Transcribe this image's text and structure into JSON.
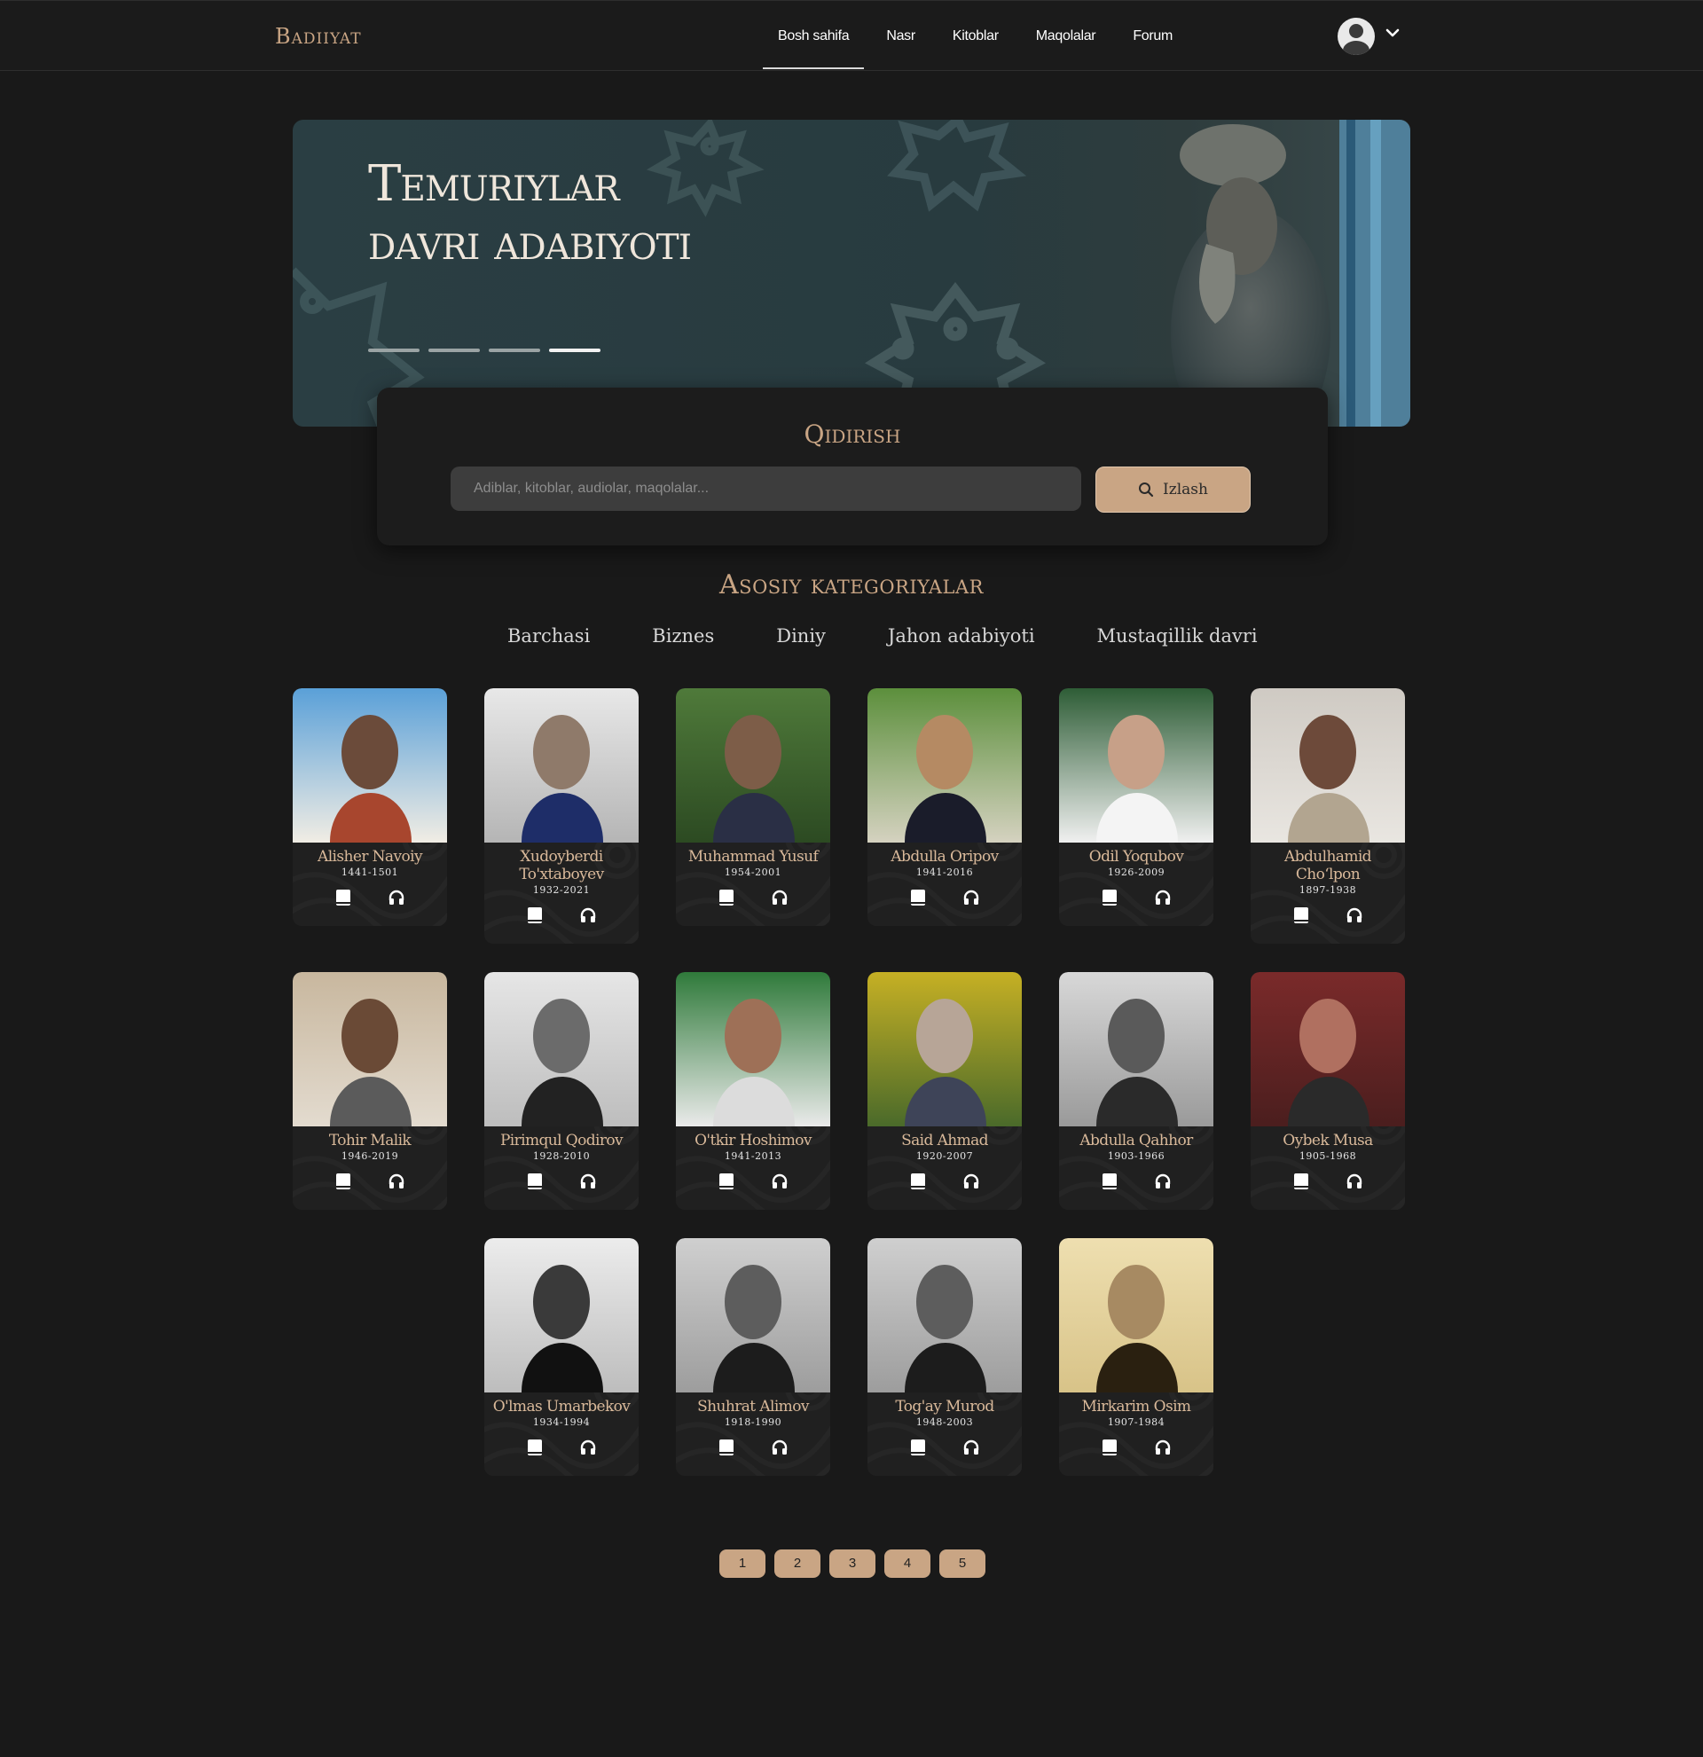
{
  "nav": {
    "logo": "Badiiyat",
    "links": [
      "Bosh sahifa",
      "Nasr",
      "Kitoblar",
      "Maqolalar",
      "Forum"
    ],
    "active_link": "Bosh sahifa"
  },
  "hero": {
    "title": "Temuriylar davri adabiyoti",
    "slides": 4,
    "active_slide": 4
  },
  "search": {
    "title": "Qidirish",
    "placeholder": "Adiblar, kitoblar, audiolar, maqolalar...",
    "button_label": "Izlash"
  },
  "categories": {
    "title": "Asosiy kategoriyalar",
    "items": [
      "Barchasi",
      "Biznes",
      "Diniy",
      "Jahon adabiyoti",
      "Mustaqillik davri"
    ]
  },
  "authors": [
    {
      "name": "Alisher Navoiy",
      "years": "1441-1501"
    },
    {
      "name": "Xudoyberdi To'xtaboyev",
      "years": "1932-2021"
    },
    {
      "name": "Muhammad Yusuf",
      "years": "1954-2001"
    },
    {
      "name": "Abdulla Oripov",
      "years": "1941-2016"
    },
    {
      "name": "Odil Yoqubov",
      "years": "1926-2009"
    },
    {
      "name": "Abdulhamid Cho‘lpon",
      "years": "1897-1938"
    },
    {
      "name": "Tohir Malik",
      "years": "1946-2019"
    },
    {
      "name": "Pirimqul Qodirov",
      "years": "1928-2010"
    },
    {
      "name": "O'tkir Hoshimov",
      "years": "1941-2013"
    },
    {
      "name": "Said Ahmad",
      "years": "1920-2007"
    },
    {
      "name": "Abdulla Qahhor",
      "years": "1903-1966"
    },
    {
      "name": "Oybek Musa",
      "years": "1905-1968"
    },
    {
      "name": "O'lmas Umarbekov",
      "years": "1934-1994"
    },
    {
      "name": "Shuhrat Alimov",
      "years": "1918-1990"
    },
    {
      "name": "Tog'ay Murod",
      "years": "1948-2003"
    },
    {
      "name": "Mirkarim Osim",
      "years": "1907-1984"
    }
  ],
  "pagination": [
    "1",
    "2",
    "3",
    "4",
    "5"
  ],
  "colors": {
    "accent": "#c9a584",
    "background": "#191919",
    "card": "#202020"
  },
  "icons": {
    "book": "book-icon",
    "audio": "headphones-icon",
    "search": "search-icon",
    "user": "avatar",
    "dropdown": "chevron-down-icon"
  }
}
